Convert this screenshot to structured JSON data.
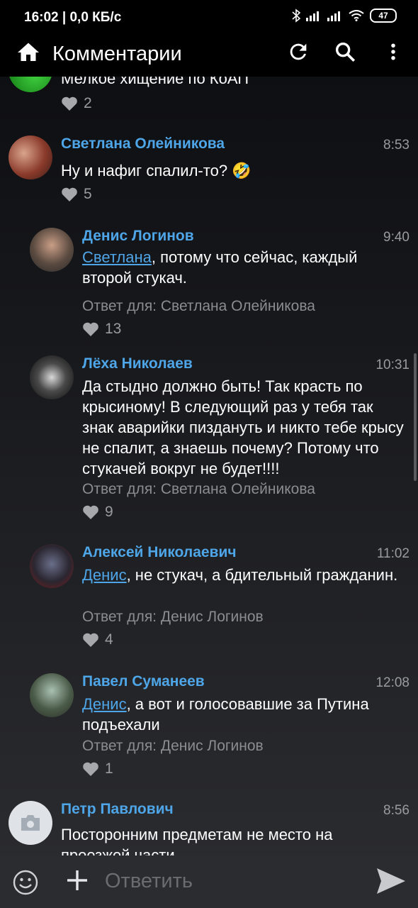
{
  "status": {
    "time": "16:02 | 0,0 КБ/с",
    "battery": "47"
  },
  "appbar": {
    "title": "Комментарии"
  },
  "comments": [
    {
      "name": "",
      "time": "",
      "text": "Мелкое хищение по КоАП",
      "reply_to": "",
      "likes": "2"
    },
    {
      "name": "Светлана Олейникова",
      "time": "8:53",
      "text": "Ну и нафиг спалил-то?",
      "emoji": "🤣",
      "reply_to": "",
      "likes": "5"
    },
    {
      "name": "Денис Логинов",
      "time": "9:40",
      "mention": "Светлана",
      "text": ", потому что сейчас, каждый второй стукач.",
      "reply_to": "Ответ для: Светлана Олейникова",
      "likes": "13"
    },
    {
      "name": "Лёха Николаев",
      "time": "10:31",
      "text": "Да стыдно должно быть! Так красть по крысиному! В следующий раз у тебя так знак аварийки пиздануть и никто тебе крысу не спалит, а знаешь почему? Потому что стукачей вокруг не будет!!!!",
      "reply_to": "Ответ для: Светлана Олейникова",
      "likes": "9"
    },
    {
      "name": "Алексей Николаевич",
      "time": "11:02",
      "mention": "Денис",
      "text": ", не стукач, а бдительный гражданин.",
      "reply_to": "Ответ для: Денис Логинов",
      "likes": "4"
    },
    {
      "name": "Павел Суманеев",
      "time": "12:08",
      "mention": "Денис",
      "text": ", а вот и голосовавшие за Путина подъехали",
      "reply_to": "Ответ для: Денис Логинов",
      "likes": "1"
    },
    {
      "name": "Петр Павлович",
      "time": "8:56",
      "text": "Посторонним предметам не место на проезжей части",
      "reply_to": "",
      "likes": ""
    }
  ],
  "composer": {
    "placeholder": "Ответить"
  },
  "colors": {
    "accent": "#4ea6e8",
    "background": "#1c1d21",
    "topbar": "#000000"
  }
}
